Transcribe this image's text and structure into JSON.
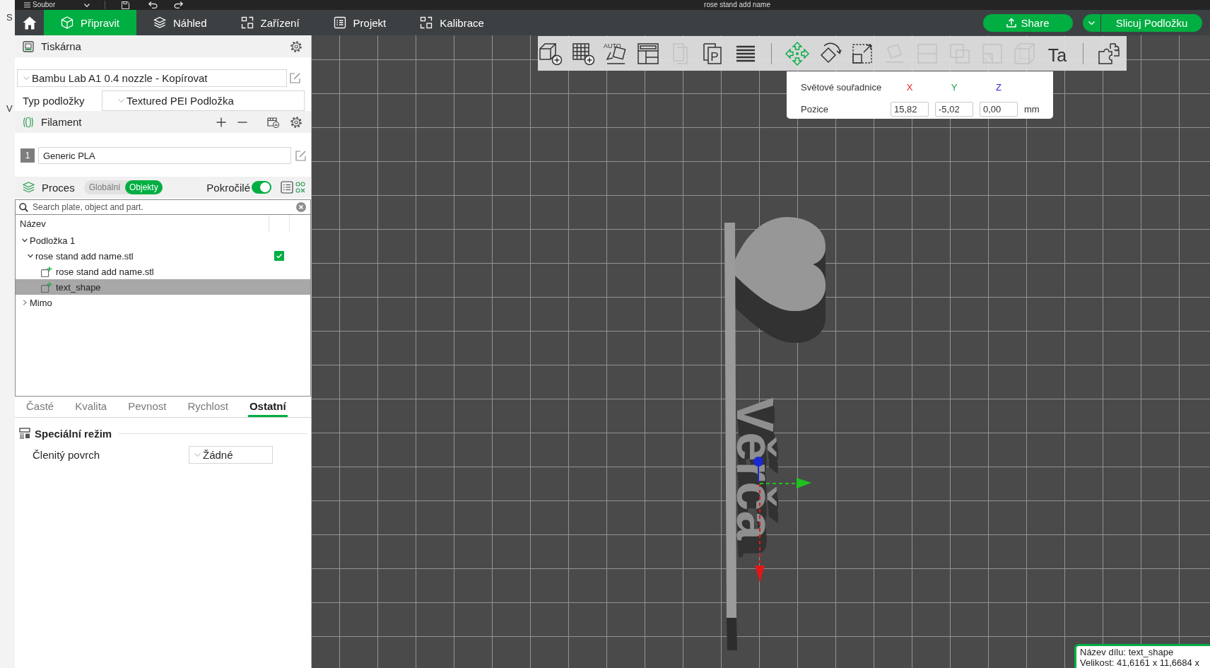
{
  "background_window": {
    "texts": [
      "S",
      "V"
    ]
  },
  "title_bar": {
    "menu": "Soubor",
    "title": "rose stand add name"
  },
  "top_bar": {
    "tabs": [
      {
        "label": "Připravit",
        "selected": true
      },
      {
        "label": "Náhled",
        "selected": false
      },
      {
        "label": "Zařízení",
        "selected": false
      },
      {
        "label": "Projekt",
        "selected": false
      },
      {
        "label": "Kalibrace",
        "selected": false
      }
    ],
    "share": "Share",
    "slice": "Slicuj Podložku"
  },
  "sidebar": {
    "printer": {
      "title": "Tiskárna",
      "profile": "Bambu Lab A1 0.4 nozzle - Kopírovat",
      "plate_label": "Typ podložky",
      "plate_type": "Textured PEI Podložka"
    },
    "filament": {
      "title": "Filament",
      "items": [
        {
          "number": "1",
          "name": "Generic PLA"
        }
      ]
    },
    "process": {
      "title": "Proces",
      "modes": [
        {
          "label": "Globální",
          "selected": false
        },
        {
          "label": "Objekty",
          "selected": true
        }
      ],
      "advanced": {
        "label": "Pokročilé",
        "on": true
      }
    },
    "object_list": {
      "search": {
        "placeholder": "Search plate, object and part."
      },
      "column": "Název",
      "items": [
        {
          "label": "Podložka 1",
          "kind": "plate",
          "expanded": true,
          "selected": false,
          "children": [
            {
              "label": "rose stand add name.stl",
              "kind": "object",
              "expanded": true,
              "checked": true,
              "selected": false,
              "children": [
                {
                  "label": "rose stand add name.stl",
                  "kind": "part",
                  "selected": false
                },
                {
                  "label": "text_shape",
                  "kind": "part",
                  "selected": true
                }
              ]
            }
          ]
        },
        {
          "label": "Mimo",
          "kind": "plate",
          "expanded": false,
          "selected": false
        }
      ]
    },
    "settings_tabs": [
      {
        "label": "Časté",
        "selected": false
      },
      {
        "label": "Kvalita",
        "selected": false
      },
      {
        "label": "Pevnost",
        "selected": false
      },
      {
        "label": "Rychlost",
        "selected": false
      },
      {
        "label": "Ostatní",
        "selected": true
      }
    ],
    "sections": [
      {
        "title": "Speciální režim",
        "rows": [
          {
            "label": "Členitý povrch",
            "value": "Žádné"
          }
        ]
      }
    ]
  },
  "viewport": {
    "toolbar": {
      "groups": [
        {
          "tools": [
            {
              "selected": false,
              "disabled": false
            },
            {
              "selected": false,
              "disabled": false
            },
            {
              "glyph": "AUTO",
              "selected": false,
              "disabled": false
            },
            {
              "selected": false,
              "disabled": false
            },
            {
              "selected": false,
              "disabled": true
            },
            {
              "glyph": "P",
              "selected": false,
              "disabled": false
            },
            {
              "selected": false,
              "disabled": false
            }
          ]
        },
        {
          "tools": [
            {
              "selected": true,
              "disabled": false
            },
            {
              "selected": false,
              "disabled": false
            },
            {
              "selected": false,
              "disabled": false
            },
            {
              "selected": false,
              "disabled": true
            },
            {
              "selected": false,
              "disabled": true
            },
            {
              "selected": false,
              "disabled": true
            },
            {
              "selected": false,
              "disabled": true
            },
            {
              "selected": false,
              "disabled": true
            },
            {
              "glyph": "Ta",
              "selected": false,
              "disabled": false
            }
          ]
        },
        {
          "tools": [
            {
              "selected": false,
              "disabled": false
            }
          ]
        }
      ]
    },
    "coordinates": {
      "title": "Světové souřadnice",
      "axes": [
        {
          "label": "X",
          "color": "#e02424"
        },
        {
          "label": "Y",
          "color": "#1e9e4a"
        },
        {
          "label": "Z",
          "color": "#2a2ad0"
        }
      ],
      "rows": [
        {
          "label": "Pozice",
          "values": [
            "15,82",
            "-5,02",
            "0,00"
          ],
          "unit": "mm"
        }
      ]
    },
    "model": {
      "text": "Věrča"
    },
    "part_info": {
      "lines": [
        "Název dílu: text_shape",
        "Velikost: 41,6161 x 11,6684 x"
      ]
    }
  }
}
